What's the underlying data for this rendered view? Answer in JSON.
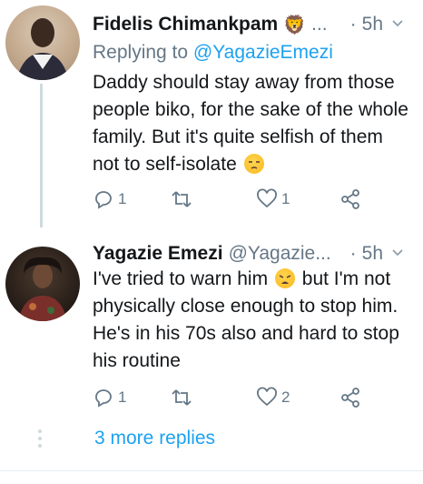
{
  "tweets": [
    {
      "name": "Fidelis Chimankpam",
      "badge": "🦁",
      "handle": "...",
      "sep": "·",
      "time": "5h",
      "replying_label": "Replying to",
      "replying_to": "@YagazieEmezi",
      "body": "Daddy should stay away from those people biko, for the sake of the whole family. But it's quite selfish of them not to self-isolate",
      "reply_count": "1",
      "retweet_count": "",
      "like_count": "1"
    },
    {
      "name": "Yagazie Emezi",
      "handle": "@Yagazie...",
      "sep": "·",
      "time": "5h",
      "body_part1": "I've tried to warn him",
      "body_part2": "but I'm not physically close enough to stop him. He's in his 70s also and hard to stop his routine",
      "reply_count": "1",
      "retweet_count": "",
      "like_count": "2"
    }
  ],
  "more_replies": "3 more replies",
  "colors": {
    "accent": "#1da1f2",
    "muted": "#657786",
    "thread": "#cfd9de"
  },
  "icons": [
    "reply-icon",
    "retweet-icon",
    "like-icon",
    "share-icon",
    "chevron-down-icon",
    "unamused-emoji-icon",
    "weary-emoji-icon"
  ]
}
